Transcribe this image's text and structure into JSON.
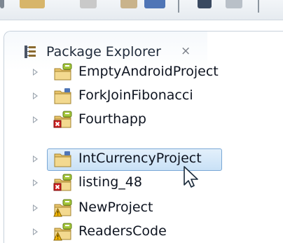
{
  "view": {
    "title": "Package Explorer",
    "close_glyph": "⨯",
    "icon": "package-explorer-icon"
  },
  "colors": {
    "selection_fill": "#cfe4f7",
    "selection_border": "#7aa8d6",
    "folder": "#e8c36a",
    "error_badge": "#d21f1f",
    "warning_badge": "#f0b400"
  },
  "tree": {
    "items": [
      {
        "label": "EmptyAndroidProject",
        "icon": "android-project-icon",
        "badge": "none",
        "selected": false
      },
      {
        "label": "ForkJoinFibonacci",
        "icon": "java-project-icon",
        "badge": "none",
        "selected": false
      },
      {
        "label": "Fourthapp",
        "icon": "android-project-icon",
        "badge": "error",
        "selected": false
      },
      {
        "label": "IntCurrencyProject",
        "icon": "java-project-icon",
        "badge": "none",
        "selected": true
      },
      {
        "label": "listing_48",
        "icon": "android-project-icon",
        "badge": "error",
        "selected": false
      },
      {
        "label": "NewProject",
        "icon": "android-project-icon",
        "badge": "warning",
        "selected": false
      },
      {
        "label": "ReadersCode",
        "icon": "android-project-icon",
        "badge": "warning",
        "selected": false
      }
    ]
  }
}
